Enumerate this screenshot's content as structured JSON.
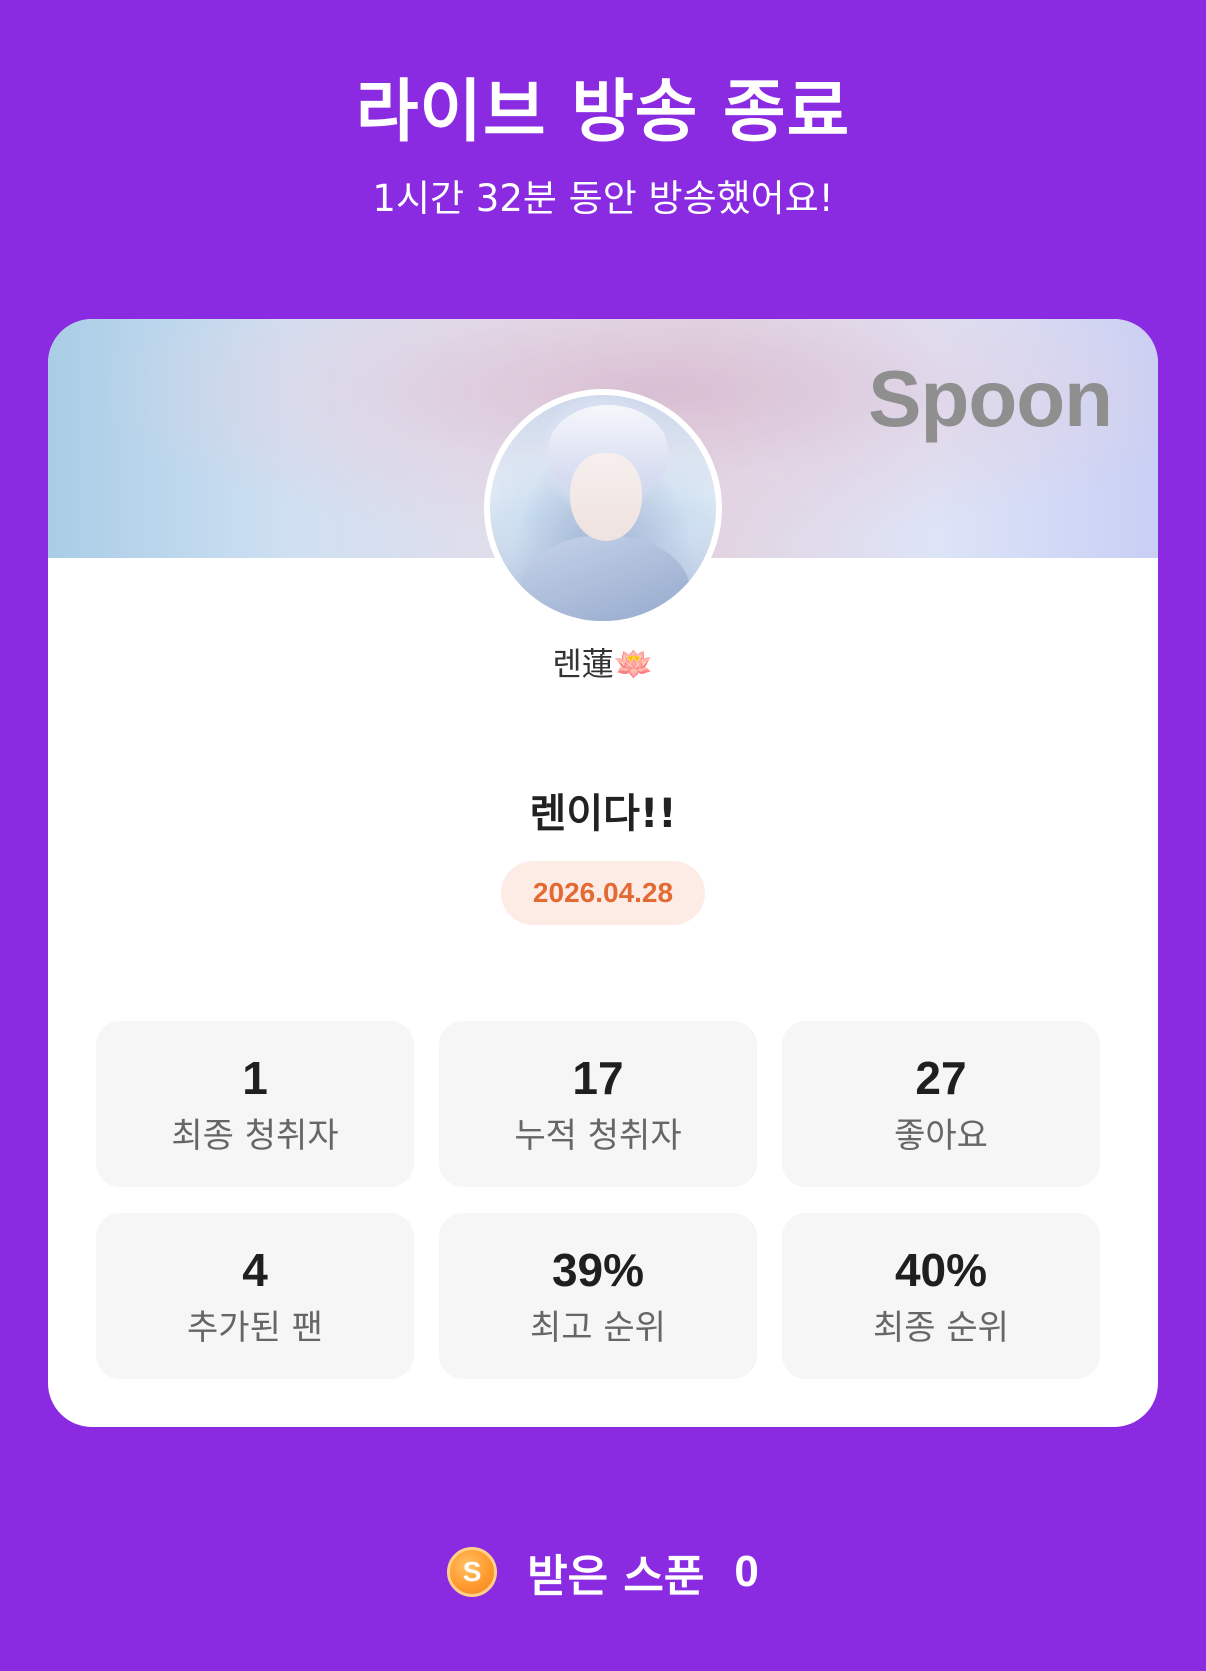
{
  "header": {
    "title": "라이브 방송 종료",
    "subtitle": "1시간 32분 동안 방송했어요!"
  },
  "card": {
    "brand": "Spoon",
    "username": "렌蓮🪷",
    "live_title": "렌이다!!",
    "date": "2026.04.28",
    "stats": [
      {
        "value": "1",
        "label": "최종 청취자"
      },
      {
        "value": "17",
        "label": "누적 청취자"
      },
      {
        "value": "27",
        "label": "좋아요"
      },
      {
        "value": "4",
        "label": "추가된 팬"
      },
      {
        "value": "39%",
        "label": "최고 순위"
      },
      {
        "value": "40%",
        "label": "최종 순위"
      }
    ]
  },
  "footer": {
    "coin_icon_letter": "S",
    "label": "받은 스푼",
    "count": "0"
  },
  "colors": {
    "background": "#8a2be2",
    "date_badge_bg": "#fdebe6",
    "date_badge_text": "#e46a34",
    "coin": "#ff9a2e"
  }
}
